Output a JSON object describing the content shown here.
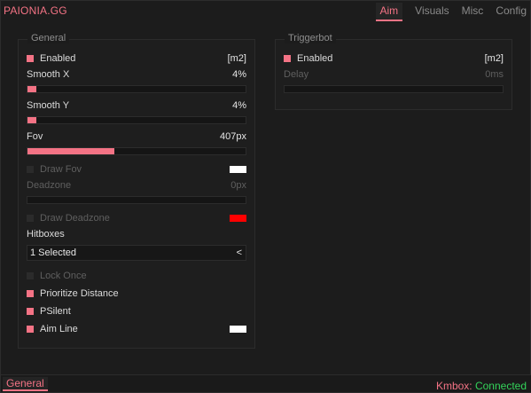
{
  "app": {
    "title": "PAIONIA.GG"
  },
  "tabs": [
    "Aim",
    "Visuals",
    "Misc",
    "Config"
  ],
  "general": {
    "title": "General",
    "enabled": {
      "label": "Enabled",
      "key": "[m2]"
    },
    "smooth_x": {
      "label": "Smooth X",
      "value": "4%",
      "fraction": 0.04
    },
    "smooth_y": {
      "label": "Smooth Y",
      "value": "4%",
      "fraction": 0.04
    },
    "fov": {
      "label": "Fov",
      "value": "407px",
      "fraction": 0.4
    },
    "draw_fov": {
      "label": "Draw Fov",
      "color": "#ffffff"
    },
    "deadzone": {
      "label": "Deadzone",
      "value": "0px",
      "fraction": 0
    },
    "draw_deadzone": {
      "label": "Draw Deadzone",
      "color": "#ff0000"
    },
    "hitboxes": {
      "label": "Hitboxes",
      "selected": "1 Selected",
      "arrow": "<"
    },
    "lock_once": {
      "label": "Lock Once"
    },
    "prioritize_distance": {
      "label": "Prioritize Distance"
    },
    "psilent": {
      "label": "PSilent"
    },
    "aim_line": {
      "label": "Aim Line",
      "color": "#ffffff"
    }
  },
  "triggerbot": {
    "title": "Triggerbot",
    "enabled": {
      "label": "Enabled",
      "key": "[m2]"
    },
    "delay": {
      "label": "Delay",
      "value": "0ms",
      "fraction": 0
    }
  },
  "footer": {
    "tab": "General",
    "status_label": "Kmbox: ",
    "status_value": "Connected"
  },
  "colors": {
    "accent": "#f47385",
    "connected": "#33d35a"
  }
}
